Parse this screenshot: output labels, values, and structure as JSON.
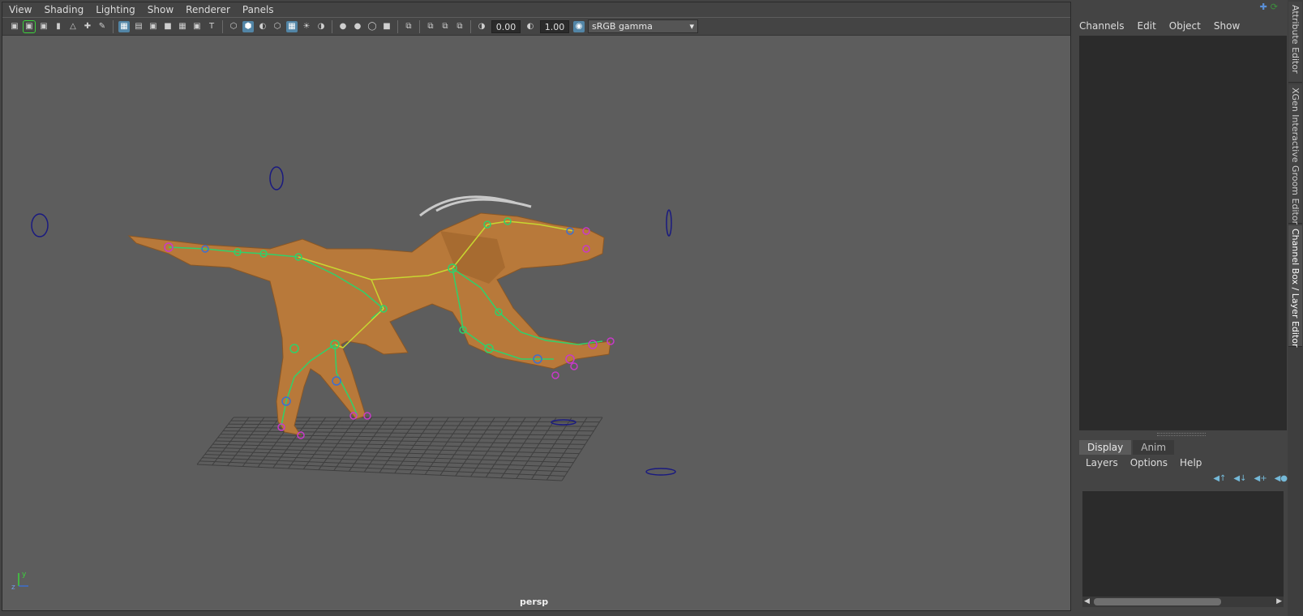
{
  "viewport": {
    "menu": [
      "View",
      "Shading",
      "Lighting",
      "Show",
      "Renderer",
      "Panels"
    ],
    "toolbar": {
      "exposure_value": "0.00",
      "gamma_value": "1.00",
      "color_space": "sRGB gamma"
    },
    "camera_label": "persp",
    "axis_labels": {
      "y": "y",
      "z": "z"
    }
  },
  "channel_box": {
    "menu": [
      "Channels",
      "Edit",
      "Object",
      "Show"
    ]
  },
  "layer_editor": {
    "tabs": [
      "Display",
      "Anim"
    ],
    "active_tab": "Display",
    "menu": [
      "Layers",
      "Options",
      "Help"
    ]
  },
  "side_tabs": [
    "Attribute Editor",
    "XGen Interactive Groom Editor",
    "Channel Box / Layer Editor"
  ],
  "colors": {
    "viewport_bg": "#5d5d5d",
    "ui_bg": "#444444",
    "panel_dark": "#2b2b2b",
    "highlight": "#5285a6",
    "creature_skin": "#b8793a",
    "joint_green": "#2fd16b",
    "joint_yellow": "#c8d631",
    "joint_blue": "#3d6fd0",
    "joint_magenta": "#c83ac8",
    "control_curve": "#1a1a80"
  }
}
